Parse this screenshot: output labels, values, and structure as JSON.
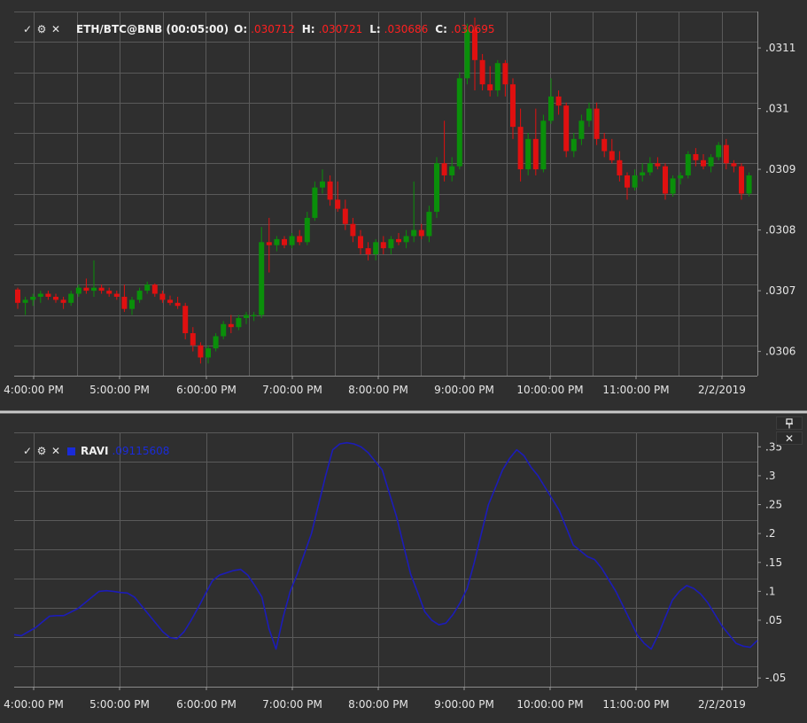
{
  "colors": {
    "background": "#2f2f2f",
    "grid": "#5a5a5a",
    "up_candle": "#0a8f0a",
    "down_candle": "#e01010",
    "ravi_line": "#1c1cb8",
    "separator": "#c8c8c8",
    "value_red": "#ff2020",
    "value_blue": "#1a2bd8"
  },
  "price_header": {
    "icons": [
      "check-icon",
      "gear-icon",
      "close-icon"
    ],
    "symbol": "ETH/BTC@BNB (00:05:00)",
    "open_label": "O:",
    "open_value": ".030712",
    "high_label": "H:",
    "high_value": ".030721",
    "low_label": "L:",
    "low_value": ".030686",
    "close_label": "C:",
    "close_value": ".030695"
  },
  "indicator_header": {
    "icons": [
      "check-icon",
      "gear-icon",
      "close-icon"
    ],
    "name": "RAVI",
    "value": ".09115608"
  },
  "pane_buttons": {
    "pin": "pin-icon",
    "close": "close-icon"
  },
  "chart_data": [
    {
      "type": "candlestick",
      "title": "ETH/BTC@BNB (00:05:00)",
      "x_tick_labels": [
        "4:00:00 PM",
        "5:00:00 PM",
        "6:00:00 PM",
        "7:00:00 PM",
        "8:00:00 PM",
        "9:00:00 PM",
        "10:00:00 PM",
        "11:00:00 PM",
        "2/2/2019"
      ],
      "y_tick_labels": [
        ".0306",
        ".0307",
        ".0308",
        ".0309",
        ".031",
        ".0311"
      ],
      "ylim": [
        0.03056,
        0.03116
      ],
      "grid": true,
      "x_start": "2019-02-01 15:45",
      "interval_minutes": 5,
      "candles": [
        [
          0.030702,
          0.030705,
          0.03067,
          0.03068
        ],
        [
          0.03068,
          0.03069,
          0.03066,
          0.030685
        ],
        [
          0.030685,
          0.030695,
          0.030675,
          0.03069
        ],
        [
          0.03069,
          0.0307,
          0.03068,
          0.030695
        ],
        [
          0.030695,
          0.0307,
          0.030685,
          0.03069
        ],
        [
          0.03069,
          0.030695,
          0.03068,
          0.030685
        ],
        [
          0.030685,
          0.03069,
          0.03067,
          0.03068
        ],
        [
          0.03068,
          0.0307,
          0.030675,
          0.030695
        ],
        [
          0.030695,
          0.03071,
          0.03069,
          0.030705
        ],
        [
          0.030705,
          0.03072,
          0.030695,
          0.0307
        ],
        [
          0.0307,
          0.03075,
          0.03069,
          0.030705
        ],
        [
          0.030705,
          0.03071,
          0.030695,
          0.0307
        ],
        [
          0.0307,
          0.030705,
          0.03069,
          0.030695
        ],
        [
          0.030695,
          0.0307,
          0.030685,
          0.03069
        ],
        [
          0.03069,
          0.03071,
          0.030665,
          0.03067
        ],
        [
          0.03067,
          0.03069,
          0.03066,
          0.030685
        ],
        [
          0.030685,
          0.030705,
          0.03068,
          0.0307
        ],
        [
          0.0307,
          0.030715,
          0.030695,
          0.03071
        ],
        [
          0.03071,
          0.030712,
          0.03069,
          0.030695
        ],
        [
          0.030695,
          0.0307,
          0.03068,
          0.030685
        ],
        [
          0.030685,
          0.030692,
          0.030676,
          0.03068
        ],
        [
          0.03068,
          0.03069,
          0.03067,
          0.030675
        ],
        [
          0.030675,
          0.03068,
          0.03062,
          0.03063
        ],
        [
          0.03063,
          0.03064,
          0.0306,
          0.03061
        ],
        [
          0.03061,
          0.030615,
          0.03058,
          0.03059
        ],
        [
          0.03059,
          0.03061,
          0.03058,
          0.030605
        ],
        [
          0.030605,
          0.03063,
          0.0306,
          0.030625
        ],
        [
          0.030625,
          0.03065,
          0.03062,
          0.030645
        ],
        [
          0.030645,
          0.03066,
          0.03063,
          0.03064
        ],
        [
          0.03064,
          0.03066,
          0.030635,
          0.030655
        ],
        [
          0.030655,
          0.030665,
          0.030645,
          0.03066
        ],
        [
          0.03066,
          0.030665,
          0.03065,
          0.03066
        ],
        [
          0.03066,
          0.030805,
          0.030655,
          0.03078
        ],
        [
          0.03078,
          0.03082,
          0.03073,
          0.030775
        ],
        [
          0.030775,
          0.03079,
          0.030765,
          0.030785
        ],
        [
          0.030785,
          0.03079,
          0.03077,
          0.030775
        ],
        [
          0.030775,
          0.030795,
          0.03077,
          0.03079
        ],
        [
          0.03079,
          0.0308,
          0.030775,
          0.03078
        ],
        [
          0.03078,
          0.03083,
          0.030775,
          0.03082
        ],
        [
          0.03082,
          0.03088,
          0.030815,
          0.03087
        ],
        [
          0.03087,
          0.0309,
          0.03086,
          0.03088
        ],
        [
          0.03088,
          0.03089,
          0.03084,
          0.03085
        ],
        [
          0.03085,
          0.03088,
          0.03083,
          0.030835
        ],
        [
          0.030835,
          0.03085,
          0.0308,
          0.03081
        ],
        [
          0.03081,
          0.03082,
          0.03078,
          0.03079
        ],
        [
          0.03079,
          0.0308,
          0.03076,
          0.03077
        ],
        [
          0.03077,
          0.03078,
          0.03075,
          0.03076
        ],
        [
          0.03076,
          0.030785,
          0.03075,
          0.03078
        ],
        [
          0.03078,
          0.03079,
          0.03076,
          0.03077
        ],
        [
          0.03077,
          0.03079,
          0.03076,
          0.030785
        ],
        [
          0.030785,
          0.030795,
          0.030775,
          0.03078
        ],
        [
          0.03078,
          0.0308,
          0.03077,
          0.03079
        ],
        [
          0.03079,
          0.03088,
          0.03078,
          0.0308
        ],
        [
          0.0308,
          0.03081,
          0.030785,
          0.03079
        ],
        [
          0.03079,
          0.03084,
          0.03078,
          0.03083
        ],
        [
          0.03083,
          0.03092,
          0.03082,
          0.03091
        ],
        [
          0.03091,
          0.03098,
          0.03088,
          0.03089
        ],
        [
          0.03089,
          0.03092,
          0.03088,
          0.030905
        ],
        [
          0.030905,
          0.03106,
          0.0309,
          0.03105
        ],
        [
          0.03105,
          0.03114,
          0.03104,
          0.03113
        ],
        [
          0.03113,
          0.03115,
          0.03103,
          0.03108
        ],
        [
          0.03108,
          0.03109,
          0.03103,
          0.03104
        ],
        [
          0.03104,
          0.03107,
          0.03102,
          0.03103
        ],
        [
          0.03103,
          0.03108,
          0.03102,
          0.031075
        ],
        [
          0.031075,
          0.03108,
          0.03102,
          0.03104
        ],
        [
          0.03104,
          0.03105,
          0.03095,
          0.03097
        ],
        [
          0.03097,
          0.031,
          0.03088,
          0.0309
        ],
        [
          0.0309,
          0.03096,
          0.03089,
          0.03095
        ],
        [
          0.03095,
          0.031,
          0.03089,
          0.0309
        ],
        [
          0.0309,
          0.03099,
          0.030895,
          0.03098
        ],
        [
          0.03098,
          0.03105,
          0.030975,
          0.03102
        ],
        [
          0.03102,
          0.03103,
          0.03099,
          0.031005
        ],
        [
          0.031005,
          0.03101,
          0.03092,
          0.03093
        ],
        [
          0.03093,
          0.03096,
          0.03092,
          0.03095
        ],
        [
          0.03095,
          0.03099,
          0.03094,
          0.03098
        ],
        [
          0.03098,
          0.03101,
          0.03097,
          0.031
        ],
        [
          0.031,
          0.03101,
          0.03094,
          0.03095
        ],
        [
          0.03095,
          0.03096,
          0.03092,
          0.03093
        ],
        [
          0.03093,
          0.03095,
          0.03091,
          0.030915
        ],
        [
          0.030915,
          0.03093,
          0.03088,
          0.03089
        ],
        [
          0.03089,
          0.030895,
          0.03085,
          0.03087
        ],
        [
          0.03087,
          0.0309,
          0.030865,
          0.03089
        ],
        [
          0.03089,
          0.03091,
          0.03088,
          0.030895
        ],
        [
          0.030895,
          0.03092,
          0.03089,
          0.03091
        ],
        [
          0.03091,
          0.03092,
          0.0309,
          0.030905
        ],
        [
          0.030905,
          0.03091,
          0.03085,
          0.03086
        ],
        [
          0.03086,
          0.03089,
          0.030855,
          0.030885
        ],
        [
          0.030885,
          0.030895,
          0.030875,
          0.03089
        ],
        [
          0.03089,
          0.03093,
          0.030885,
          0.030925
        ],
        [
          0.030925,
          0.030935,
          0.030905,
          0.030915
        ],
        [
          0.030915,
          0.030925,
          0.0309,
          0.030905
        ],
        [
          0.030905,
          0.030925,
          0.030895,
          0.03092
        ],
        [
          0.03092,
          0.030945,
          0.030915,
          0.03094
        ],
        [
          0.03094,
          0.03095,
          0.0309,
          0.03091
        ],
        [
          0.03091,
          0.030915,
          0.030895,
          0.030905
        ],
        [
          0.030905,
          0.03091,
          0.03085,
          0.03086
        ],
        [
          0.03086,
          0.030895,
          0.030855,
          0.03089
        ]
      ]
    },
    {
      "type": "line",
      "title": "RAVI",
      "x_tick_labels": [
        "4:00:00 PM",
        "5:00:00 PM",
        "6:00:00 PM",
        "7:00:00 PM",
        "8:00:00 PM",
        "9:00:00 PM",
        "10:00:00 PM",
        "11:00:00 PM",
        "2/2/2019"
      ],
      "y_tick_labels": [
        ".35",
        ".3",
        ".25",
        ".2",
        ".15",
        ".1",
        ".05",
        "-.05"
      ],
      "ylim": [
        -0.065,
        0.375
      ],
      "grid": true,
      "series": [
        {
          "name": "RAVI",
          "values": [
            0.025,
            0.023,
            0.03,
            0.037,
            0.047,
            0.057,
            0.058,
            0.058,
            0.064,
            0.07,
            0.08,
            0.09,
            0.1,
            0.101,
            0.1,
            0.098,
            0.097,
            0.09,
            0.075,
            0.06,
            0.045,
            0.03,
            0.02,
            0.018,
            0.03,
            0.05,
            0.072,
            0.095,
            0.118,
            0.128,
            0.132,
            0.136,
            0.138,
            0.128,
            0.11,
            0.09,
            0.035,
            0.0,
            0.055,
            0.1,
            0.13,
            0.165,
            0.2,
            0.25,
            0.3,
            0.345,
            0.355,
            0.357,
            0.355,
            0.35,
            0.34,
            0.325,
            0.31,
            0.27,
            0.23,
            0.18,
            0.13,
            0.098,
            0.065,
            0.05,
            0.042,
            0.045,
            0.06,
            0.08,
            0.105,
            0.15,
            0.2,
            0.25,
            0.28,
            0.31,
            0.33,
            0.345,
            0.335,
            0.315,
            0.3,
            0.28,
            0.26,
            0.24,
            0.21,
            0.18,
            0.17,
            0.16,
            0.155,
            0.14,
            0.12,
            0.1,
            0.075,
            0.05,
            0.025,
            0.01,
            0.0,
            0.025,
            0.055,
            0.085,
            0.1,
            0.11,
            0.105,
            0.095,
            0.08,
            0.06,
            0.04,
            0.025,
            0.01,
            0.005,
            0.003,
            0.015
          ]
        }
      ]
    }
  ]
}
